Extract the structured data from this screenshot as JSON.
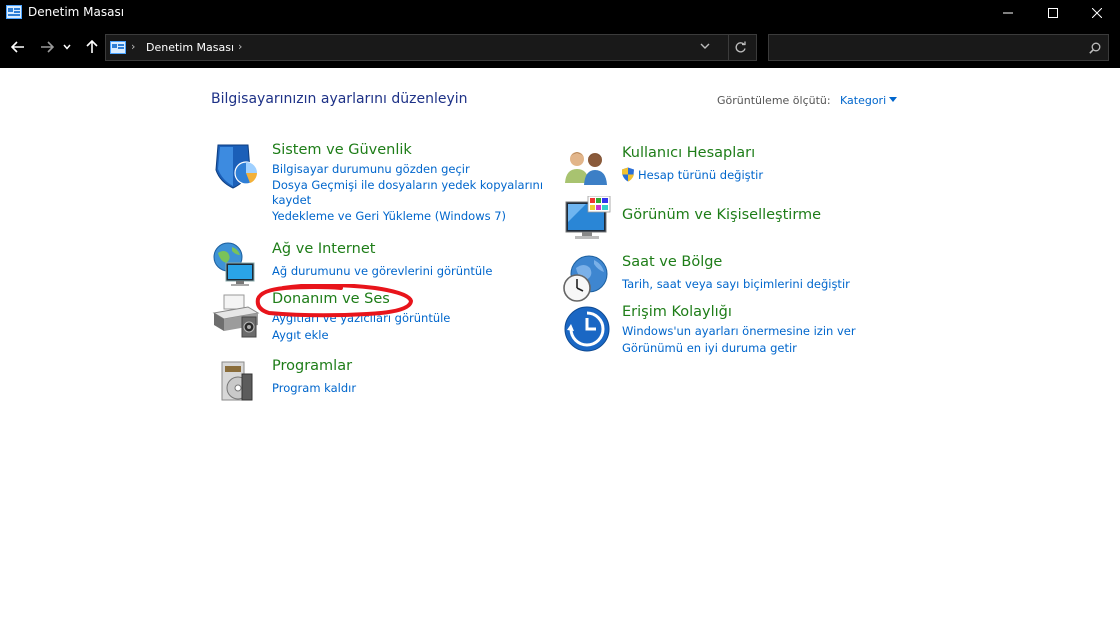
{
  "window": {
    "title": "Denetim Masası",
    "controls": {
      "minimize": "minimize",
      "maximize": "maximize",
      "close": "close"
    }
  },
  "navigation": {
    "breadcrumb": [
      "Denetim Masası"
    ],
    "search_placeholder": ""
  },
  "main": {
    "title": "Bilgisayarınızın ayarlarını düzenleyin",
    "view_by_label": "Görüntüleme ölçütü:",
    "view_by_value": "Kategori",
    "left_categories": [
      {
        "icon": "shield-icon",
        "heading": "Sistem ve Güvenlik",
        "links": [
          "Bilgisayar durumunu gözden geçir",
          "Dosya Geçmişi ile dosyaların yedek kopyalarını",
          "kaydet",
          "Yedekleme ve Geri Yükleme (Windows 7)"
        ]
      },
      {
        "icon": "network-icon",
        "heading": "Ağ ve Internet",
        "links": [
          "Ağ durumunu ve görevlerini görüntüle"
        ]
      },
      {
        "icon": "printer-icon",
        "heading": "Donanım ve Ses",
        "links": [
          "Aygıtları ve yazıcıları görüntüle",
          "Aygıt ekle"
        ]
      },
      {
        "icon": "programs-icon",
        "heading": "Programlar",
        "links": [
          "Program kaldır"
        ]
      }
    ],
    "right_categories": [
      {
        "icon": "users-icon",
        "heading": "Kullanıcı Hesapları",
        "links": [
          "Hesap türünü değiştir"
        ]
      },
      {
        "icon": "display-icon",
        "heading": "Görünüm ve Kişiselleştirme",
        "links": []
      },
      {
        "icon": "clock-globe-icon",
        "heading": "Saat ve Bölge",
        "links": [
          "Tarih, saat veya sayı biçimlerini değiştir"
        ]
      },
      {
        "icon": "ease-of-access-icon",
        "heading": "Erişim Kolaylığı",
        "links": [
          "Windows'un ayarları önermesine izin ver",
          "Görünümü en iyi duruma getir"
        ]
      }
    ]
  },
  "colors": {
    "title_bar": "#000000",
    "heading_green": "#1e7d18",
    "link_blue": "#0066cc",
    "page_title_blue": "#1e3287",
    "annotation_red": "#e8141b"
  }
}
